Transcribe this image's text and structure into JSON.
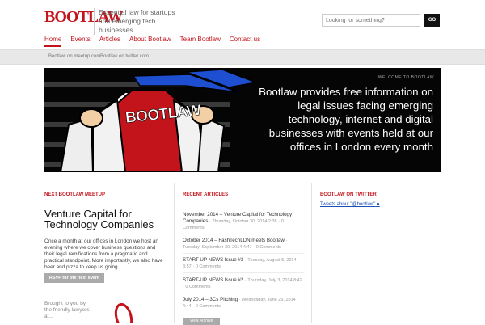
{
  "header": {
    "logo": "BOOTLAW",
    "tagline": "Essential law for startups and emerging tech businesses",
    "search_placeholder": "Looking for something?",
    "search_button": "GO"
  },
  "nav": {
    "items": [
      "Home",
      "Events",
      "Articles",
      "About Bootlaw",
      "Team Bootlaw",
      "Contact us"
    ]
  },
  "subbar": {
    "links": [
      "Bootlaw on meetup.com",
      "Bootlaw on twitter.com"
    ]
  },
  "hero": {
    "label": "WELCOME TO BOOTLAW",
    "image_text": "BOOTLAW",
    "headline": "Bootlaw provides free information on legal issues facing emerging technology, internet and digital businesses with events held at our offices in London every month"
  },
  "meetup": {
    "section_title": "NEXT BOOTLAW MEETUP",
    "heading": "Venture Capital for Technology Companies",
    "body": "Once a month at our offices in London we host an evening where we cover business questions and their legal ramifications from a pragmatic and practical standpoint. More importantly, we also have beer and pizza to keep us going.",
    "rsvp": "RSVP for the next event",
    "brought_by": "Brought to you by the friendly lawyers at..."
  },
  "recent": {
    "section_title": "RECENT ARTICLES",
    "articles": [
      {
        "title": "November 2014 – Venture Capital for Technology Companies",
        "date": "Thursday, October 30, 2014 2:38",
        "comments": "0 Comments"
      },
      {
        "title": "October 2014 – FashTechLDN meets Bootlaw",
        "date": "Tuesday, September 30, 2014 4:47",
        "comments": "0 Comments"
      },
      {
        "title": "START-UP NEWS Issue #3",
        "date": "Tuesday, August 5, 2014 3:57",
        "comments": "0 Comments"
      },
      {
        "title": "START-UP NEWS Issue #2",
        "date": "Thursday, July 3, 2014 8:42",
        "comments": "0 Comments"
      },
      {
        "title": "July 2014 – 3Cs Pitching",
        "date": "Wednesday, June 25, 2014 4:44",
        "comments": "0 Comments"
      }
    ],
    "archive": "View Archive"
  },
  "twitter": {
    "section_title": "BOOTLAW ON TWITTER",
    "link": "Tweets about \"@bootlaw\""
  },
  "colors": {
    "brand": "#c3141c",
    "hero_bg": "#050505"
  }
}
